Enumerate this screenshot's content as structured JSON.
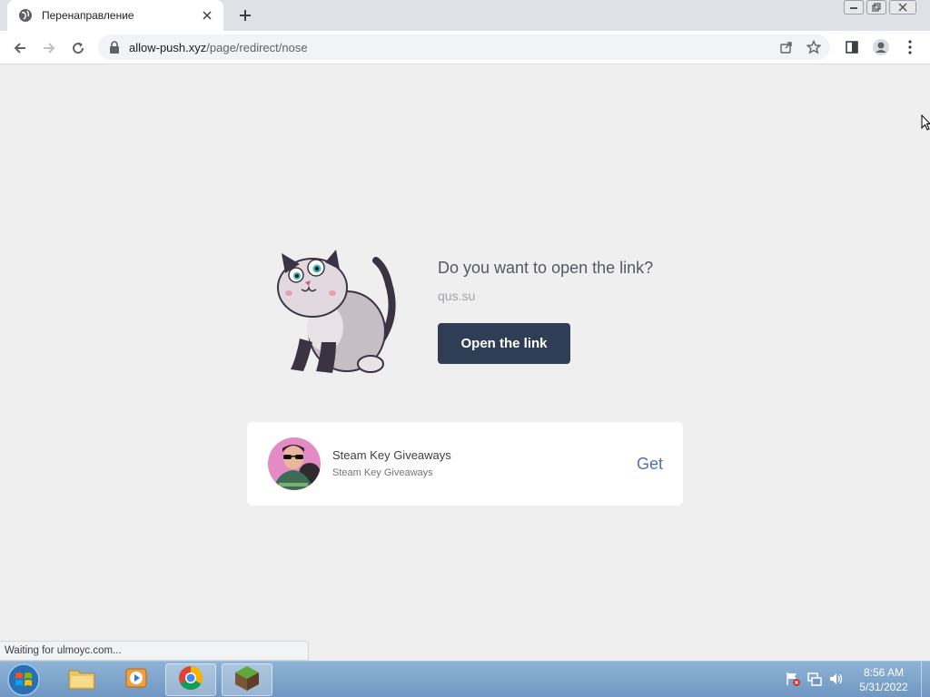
{
  "tab": {
    "title": "Перенаправление"
  },
  "address_bar": {
    "host": "allow-push.xyz",
    "path": "/page/redirect/nose"
  },
  "prompt": {
    "question": "Do you want to open the link?",
    "target_host": "qus.su",
    "button_label": "Open the link"
  },
  "card": {
    "name": "Steam Key Giveaways",
    "subtitle": "Steam Key Giveaways",
    "action_label": "Get"
  },
  "status_bar": {
    "text": "Waiting for ulmoyc.com..."
  },
  "taskbar": {
    "time": "8:56 AM",
    "date": "5/31/2022",
    "apps": [
      "file-explorer-icon",
      "media-player-icon",
      "chrome-icon",
      "minecraft-icon"
    ]
  },
  "colors": {
    "button_bg": "#2f3e55",
    "get_link": "#4f6fb8",
    "page_bg": "#efefef"
  }
}
